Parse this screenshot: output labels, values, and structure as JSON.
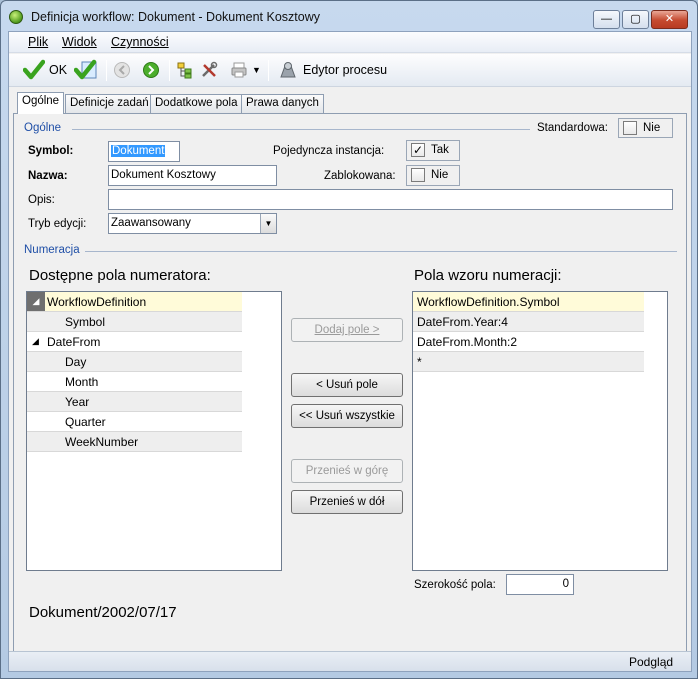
{
  "window": {
    "title": "Definicja workflow: Dokument - Dokument Kosztowy",
    "minimize": "—",
    "maximize": "▢",
    "close": "✕"
  },
  "menu": {
    "file": "Plik",
    "view": "Widok",
    "actions": "Czynności"
  },
  "toolbar": {
    "ok_label": "OK",
    "editor_label": "Edytor procesu"
  },
  "tabs": [
    "Ogólne",
    "Definicje zadań",
    "Dodatkowe pola",
    "Prawa danych"
  ],
  "general": {
    "section_label": "Ogólne",
    "standard_label": "Standardowa:",
    "standard_value": "Nie",
    "symbol_label": "Symbol:",
    "symbol_value": "Dokument",
    "single_instance_label": "Pojedyncza instancja:",
    "single_instance_value": "Tak",
    "name_label": "Nazwa:",
    "name_value": "Dokument Kosztowy",
    "locked_label": "Zablokowana:",
    "locked_value": "Nie",
    "description_label": "Opis:",
    "description_value": "",
    "edit_mode_label": "Tryb edycji:",
    "edit_mode_value": "Zaawansowany"
  },
  "numbering": {
    "section_label": "Numeracja",
    "available_label": "Dostępne pola numeratora:",
    "pattern_label": "Pola wzoru numeracji:",
    "available_fields": [
      {
        "label": "WorkflowDefinition"
      },
      {
        "label": "Symbol"
      },
      {
        "label": "DateFrom"
      },
      {
        "label": "Day"
      },
      {
        "label": "Month"
      },
      {
        "label": "Year"
      },
      {
        "label": "Quarter"
      },
      {
        "label": "WeekNumber"
      }
    ],
    "pattern_fields": [
      "WorkflowDefinition.Symbol",
      "DateFrom.Year:4",
      "DateFrom.Month:2",
      "*"
    ],
    "add_button": "Dodaj pole >",
    "remove_button": "< Usuń pole",
    "remove_all_button": "<< Usuń wszystkie",
    "move_up_button": "Przenieś w górę",
    "move_down_button": "Przenieś w dół",
    "width_label": "Szerokość pola:",
    "width_value": "0",
    "preview": "Dokument/2002/07/17"
  },
  "status": {
    "preview_label": "Podgląd"
  }
}
